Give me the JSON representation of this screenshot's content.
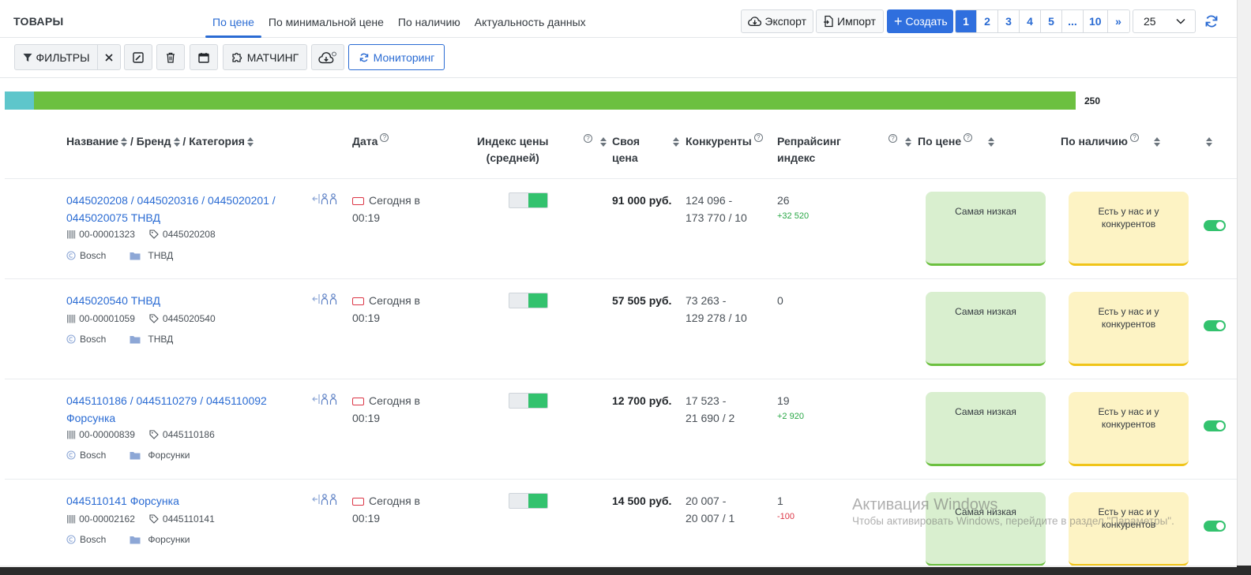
{
  "header": {
    "title": "ТОВАРЫ",
    "tabs": [
      {
        "label": "По цене"
      },
      {
        "label": "По минимальной цене"
      },
      {
        "label": "По наличию"
      },
      {
        "label": "Актуальность данных"
      }
    ],
    "export_label": "Экспорт",
    "import_label": "Импорт",
    "create_label": "Создать",
    "pages": [
      "1",
      "2",
      "3",
      "4",
      "5",
      "...",
      "10",
      "»"
    ],
    "active_page": "1",
    "per_page": "25"
  },
  "toolbar": {
    "filters_label": "ФИЛЬТРЫ",
    "matching_label": "МАТЧИНГ",
    "monitoring_label": "Мониторинг"
  },
  "progress": {
    "total": "250",
    "teal_fraction": 0.027
  },
  "columns": {
    "name": "Название",
    "brand": "Бренд",
    "category": "Категория",
    "date": "Дата",
    "price_index_1": "Индекс цены",
    "price_index_2": "(средней)",
    "own_price_1": "Своя",
    "own_price_2": "цена",
    "competitors": "Конкуренты",
    "repricing_1": "Репрайсинг",
    "repricing_2": "индекс",
    "by_price": "По цене",
    "by_availability": "По наличию"
  },
  "rows": [
    {
      "name_1": "0445020208 / 0445020316 / 0445020201 /",
      "name_2": "0445020075 ТНВД",
      "code": "00-00001323",
      "tag": "0445020208",
      "brand": "Bosch",
      "category": "ТНВД",
      "date_1": "Сегодня в",
      "date_2": "00:19",
      "price": "91 000 руб.",
      "comp_1": "124 096 -",
      "comp_2": "173 770 / 10",
      "rep": "26",
      "rep_delta": "+32 520",
      "by_price": "Самая низкая",
      "by_availability": "Есть у нас и у конкурентов"
    },
    {
      "name_1": "0445020540 ТНВД",
      "name_2": "",
      "code": "00-00001059",
      "tag": "0445020540",
      "brand": "Bosch",
      "category": "ТНВД",
      "date_1": "Сегодня в",
      "date_2": "00:19",
      "price": "57 505 руб.",
      "comp_1": "73 263 -",
      "comp_2": "129 278 / 10",
      "rep": "0",
      "rep_delta": "",
      "by_price": "Самая низкая",
      "by_availability": "Есть у нас и у конкурентов"
    },
    {
      "name_1": "0445110186 / 0445110279 / 0445110092",
      "name_2": "Форсунка",
      "code": "00-00000839",
      "tag": "0445110186",
      "brand": "Bosch",
      "category": "Форсунки",
      "date_1": "Сегодня в",
      "date_2": "00:19",
      "price": "12 700 руб.",
      "comp_1": "17 523 -",
      "comp_2": "21 690 / 2",
      "rep": "19",
      "rep_delta": "+2 920",
      "by_price": "Самая низкая",
      "by_availability": "Есть у нас и у конкурентов"
    },
    {
      "name_1": "0445110141 Форсунка",
      "name_2": "",
      "code": "00-00002162",
      "tag": "0445110141",
      "brand": "Bosch",
      "category": "Форсунки",
      "date_1": "Сегодня в",
      "date_2": "00:19",
      "price": "14 500 руб.",
      "comp_1": "20 007 -",
      "comp_2": "20 007 / 1",
      "rep": "1",
      "rep_delta": "-100",
      "by_price": "Самая низкая",
      "by_availability": "Есть у нас и у конкурентов"
    }
  ],
  "watermark": {
    "line_1": "Активация Windows",
    "line_2": "Чтобы активировать Windows, перейдите в раздел \"Параметры\"."
  },
  "colors": {
    "accent": "#2f6fde",
    "progress_green": "#6cc040",
    "progress_teal": "#5ec6cb",
    "toggle_on": "#33c26e",
    "card_green": "#d9efcf",
    "card_yellow": "#fdf3c4"
  }
}
